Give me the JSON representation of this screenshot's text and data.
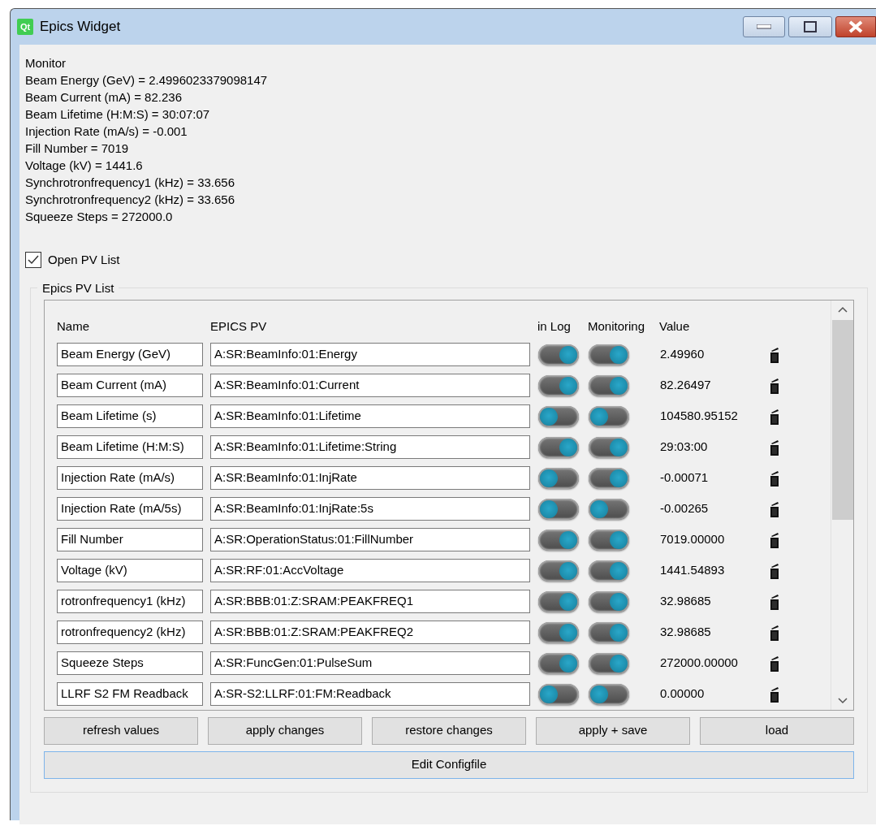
{
  "window": {
    "logo": "Qt",
    "title": "Epics Widget"
  },
  "monitor": {
    "heading": "Monitor",
    "lines": [
      "Beam Energy (GeV) = 2.4996023379098147",
      "Beam Current (mA) = 82.236",
      "Beam Lifetime (H:M:S) = 30:07:07",
      "Injection Rate (mA/s) = -0.001",
      "Fill Number = 7019",
      "Voltage (kV) = 1441.6",
      "Synchrotronfrequency1 (kHz) = 33.656",
      "Synchrotronfrequency2 (kHz) = 33.656",
      "Squeeze Steps = 272000.0"
    ]
  },
  "open_pv_list": {
    "label": "Open PV List",
    "checked": true
  },
  "pv_list": {
    "title": "Epics PV List",
    "columns": [
      "Name",
      "EPICS PV",
      "in Log",
      "Monitoring",
      "Value"
    ],
    "rows": [
      {
        "name": "Beam Energy (GeV)",
        "pv": "A:SR:BeamInfo:01:Energy",
        "in_log": true,
        "monitoring": true,
        "value": "2.49960"
      },
      {
        "name": "Beam Current (mA)",
        "pv": "A:SR:BeamInfo:01:Current",
        "in_log": true,
        "monitoring": true,
        "value": "82.26497"
      },
      {
        "name": "Beam Lifetime (s)",
        "pv": "A:SR:BeamInfo:01:Lifetime",
        "in_log": false,
        "monitoring": false,
        "value": "104580.95152"
      },
      {
        "name": "Beam Lifetime (H:M:S)",
        "pv": "A:SR:BeamInfo:01:Lifetime:String",
        "in_log": true,
        "monitoring": true,
        "value": "29:03:00"
      },
      {
        "name": "Injection Rate (mA/s)",
        "pv": "A:SR:BeamInfo:01:InjRate",
        "in_log": false,
        "monitoring": true,
        "value": "-0.00071"
      },
      {
        "name": "Injection Rate (mA/5s)",
        "pv": "A:SR:BeamInfo:01:InjRate:5s",
        "in_log": false,
        "monitoring": false,
        "value": "-0.00265"
      },
      {
        "name": "Fill Number",
        "pv": "A:SR:OperationStatus:01:FillNumber",
        "in_log": true,
        "monitoring": true,
        "value": "7019.00000"
      },
      {
        "name": "Voltage (kV)",
        "pv": "A:SR:RF:01:AccVoltage",
        "in_log": true,
        "monitoring": true,
        "value": "1441.54893"
      },
      {
        "name": "rotronfrequency1 (kHz)",
        "pv": "A:SR:BBB:01:Z:SRAM:PEAKFREQ1",
        "in_log": true,
        "monitoring": true,
        "value": "32.98685"
      },
      {
        "name": "rotronfrequency2 (kHz)",
        "pv": "A:SR:BBB:01:Z:SRAM:PEAKFREQ2",
        "in_log": true,
        "monitoring": true,
        "value": "32.98685"
      },
      {
        "name": "Squeeze Steps",
        "pv": "A:SR:FuncGen:01:PulseSum",
        "in_log": true,
        "monitoring": true,
        "value": "272000.00000"
      },
      {
        "name": "LLRF S2 FM Readback",
        "pv": "A:SR-S2:LLRF:01:FM:Readback",
        "in_log": false,
        "monitoring": false,
        "value": "0.00000"
      }
    ]
  },
  "buttons": [
    "refresh values",
    "apply changes",
    "restore changes",
    "apply + save",
    "load"
  ],
  "edit_button": "Edit Configfile"
}
